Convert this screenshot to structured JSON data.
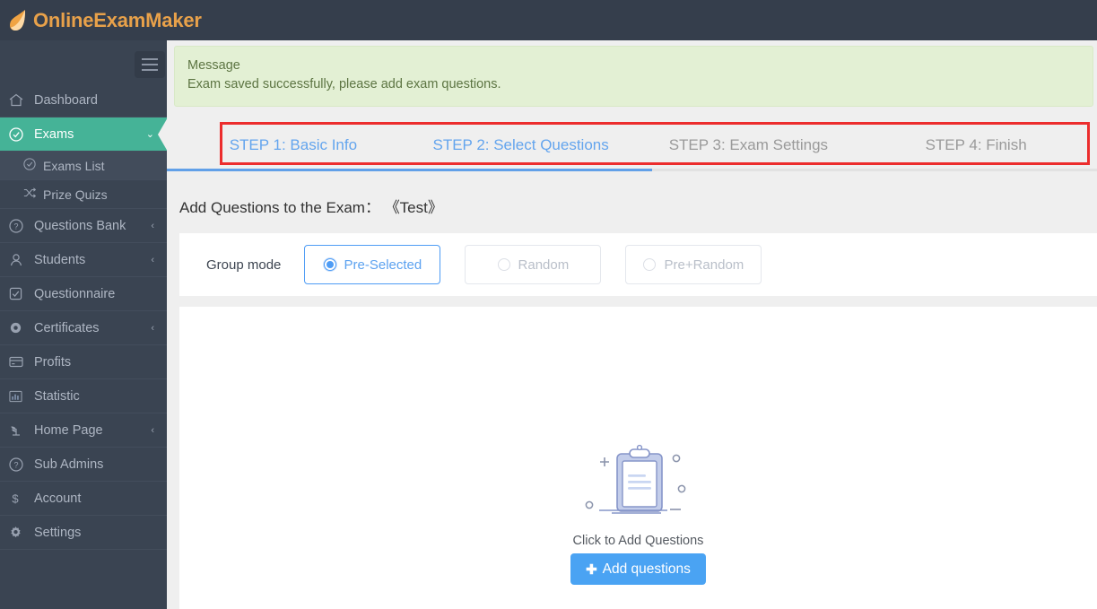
{
  "brand": {
    "name": "OnlineExamMaker",
    "logo_icon": "leaf-logo-icon",
    "accent_color": "#e8a14a"
  },
  "topbar": {
    "menu_toggle_icon": "hamburger-icon"
  },
  "sidebar": {
    "items": [
      {
        "label": "Dashboard",
        "icon": "home-icon",
        "caret": "",
        "active": false
      },
      {
        "label": "Exams",
        "icon": "check-circle-icon",
        "caret": "⌄",
        "active": true
      },
      {
        "label": "Questions Bank",
        "icon": "question-circle-icon",
        "caret": "‹",
        "active": false
      },
      {
        "label": "Students",
        "icon": "user-icon",
        "caret": "‹",
        "active": false
      },
      {
        "label": "Questionnaire",
        "icon": "checkbox-icon",
        "caret": "",
        "active": false
      },
      {
        "label": "Certificates",
        "icon": "badge-icon",
        "caret": "‹",
        "active": false
      },
      {
        "label": "Profits",
        "icon": "card-icon",
        "caret": "",
        "active": false
      },
      {
        "label": "Statistic",
        "icon": "bar-chart-icon",
        "caret": "",
        "active": false
      },
      {
        "label": "Home Page",
        "icon": "plant-icon",
        "caret": "‹",
        "active": false
      },
      {
        "label": "Sub Admins",
        "icon": "question-circle-icon",
        "caret": "",
        "active": false
      },
      {
        "label": "Account",
        "icon": "dollar-icon",
        "caret": "",
        "active": false
      },
      {
        "label": "Settings",
        "icon": "gear-icon",
        "caret": "",
        "active": false
      }
    ],
    "submenu": [
      {
        "label": "Exams List",
        "icon": "check-circle-icon",
        "selected": true
      },
      {
        "label": "Prize Quizs",
        "icon": "shuffle-icon",
        "selected": false
      }
    ],
    "active_color": "#45b397",
    "background_color": "#3a4452"
  },
  "alert": {
    "title": "Message",
    "body": "Exam saved successfully, please add exam questions.",
    "background_color": "#e3f0d4",
    "text_color": "#5d7543"
  },
  "steps": {
    "highlight_color": "#ec2d2d",
    "progress_percent": 52,
    "items": [
      {
        "label": "STEP 1: Basic Info",
        "state": "done"
      },
      {
        "label": "STEP 2: Select Questions",
        "state": "done"
      },
      {
        "label": "STEP 3: Exam Settings",
        "state": "pending"
      },
      {
        "label": "STEP 4: Finish",
        "state": "pending"
      }
    ]
  },
  "page": {
    "title_prefix": "Add Questions to the Exam：",
    "exam_name": "《Test》"
  },
  "group_mode": {
    "label": "Group mode",
    "options": [
      {
        "label": "Pre-Selected",
        "checked": true
      },
      {
        "label": "Random",
        "checked": false
      },
      {
        "label": "Pre+Random",
        "checked": false
      }
    ],
    "accent_color": "#4e9cf5"
  },
  "empty_state": {
    "illustration_icon": "clipboard-illustration-icon",
    "hint": "Click to Add Questions",
    "button_label": "Add questions",
    "button_icon": "plus-icon",
    "button_color": "#4aa3f3"
  }
}
